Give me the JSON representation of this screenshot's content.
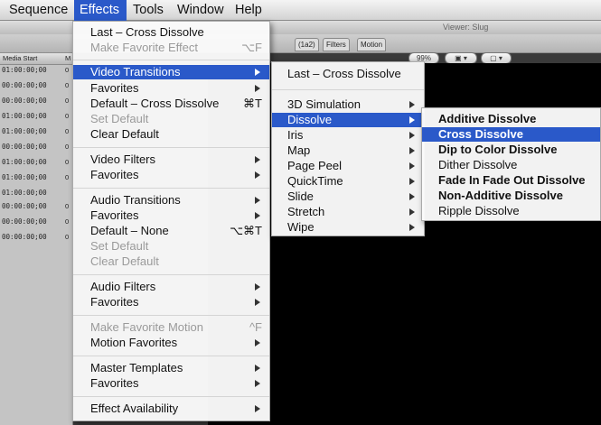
{
  "menubar": {
    "items": [
      {
        "label": "Sequence",
        "active": false
      },
      {
        "label": "Effects",
        "active": true
      },
      {
        "label": "Tools",
        "active": false
      },
      {
        "label": "Window",
        "active": false
      },
      {
        "label": "Help",
        "active": false
      }
    ]
  },
  "background": {
    "viewer_title": "Viewer: Slug",
    "viewer_tabs": [
      "(1a2)",
      "Filters",
      "Motion"
    ],
    "zoom_value": "99%",
    "browser_columns": [
      "Media Start",
      "M"
    ],
    "browser_rows": [
      {
        "tc": "01:00:00;00",
        "suffix": "0"
      },
      {
        "tc": "00:00:00;00",
        "suffix": "0"
      },
      {
        "tc": "00:00:00;00",
        "suffix": "0"
      },
      {
        "tc": "01:00:00;00",
        "suffix": "0"
      },
      {
        "tc": "01:00:00;00",
        "suffix": "0"
      },
      {
        "tc": "00:00:00;00",
        "suffix": "0"
      },
      {
        "tc": "01:00:00;00",
        "suffix": "0"
      },
      {
        "tc": "01:00:00;00",
        "suffix": "0"
      },
      {
        "tc": "01:00:00;00",
        "suffix": ""
      },
      {
        "tc": "00:00:00;00",
        "suffix": "0"
      },
      {
        "tc": "00:00:00;00",
        "suffix": "0"
      },
      {
        "tc": "00:00:00;00",
        "suffix": "0"
      }
    ]
  },
  "effects_menu": {
    "items": [
      {
        "label": "Last – Cross Dissolve"
      },
      {
        "label": "Make Favorite Effect",
        "shortcut": "⌥F",
        "disabled": true
      },
      {
        "label": "Video Transitions",
        "submenu": true,
        "highlighted": true
      },
      {
        "label": "Favorites",
        "submenu": true
      },
      {
        "label": "Default – Cross Dissolve",
        "shortcut": "⌘T"
      },
      {
        "label": "Set Default",
        "disabled": true
      },
      {
        "label": "Clear Default"
      },
      {
        "label": "Video Filters",
        "submenu": true
      },
      {
        "label": "Favorites",
        "submenu": true
      },
      {
        "label": "Audio Transitions",
        "submenu": true
      },
      {
        "label": "Favorites",
        "submenu": true
      },
      {
        "label": "Default – None",
        "shortcut": "⌥⌘T"
      },
      {
        "label": "Set Default",
        "disabled": true
      },
      {
        "label": "Clear Default",
        "disabled": true
      },
      {
        "label": "Audio Filters",
        "submenu": true
      },
      {
        "label": "Favorites",
        "submenu": true
      },
      {
        "label": "Make Favorite Motion",
        "shortcut": "^F",
        "disabled": true
      },
      {
        "label": "Motion Favorites",
        "submenu": true
      },
      {
        "label": "Master Templates",
        "submenu": true
      },
      {
        "label": "Favorites",
        "submenu": true
      },
      {
        "label": "Effect Availability",
        "submenu": true
      }
    ]
  },
  "transitions_menu": {
    "items": [
      {
        "label": "Last – Cross Dissolve"
      },
      {
        "label": "3D Simulation",
        "submenu": true
      },
      {
        "label": "Dissolve",
        "submenu": true,
        "highlighted": true
      },
      {
        "label": "Iris",
        "submenu": true
      },
      {
        "label": "Map",
        "submenu": true
      },
      {
        "label": "Page Peel",
        "submenu": true
      },
      {
        "label": "QuickTime",
        "submenu": true
      },
      {
        "label": "Slide",
        "submenu": true
      },
      {
        "label": "Stretch",
        "submenu": true
      },
      {
        "label": "Wipe",
        "submenu": true
      }
    ]
  },
  "dissolve_menu": {
    "items": [
      {
        "label": "Additive Dissolve",
        "bold": true
      },
      {
        "label": "Cross Dissolve",
        "bold": true,
        "highlighted": true
      },
      {
        "label": "Dip to Color Dissolve",
        "bold": true
      },
      {
        "label": "Dither Dissolve",
        "bold": false
      },
      {
        "label": "Fade In Fade Out Dissolve",
        "bold": true
      },
      {
        "label": "Non-Additive Dissolve",
        "bold": true
      },
      {
        "label": "Ripple Dissolve",
        "bold": false
      }
    ]
  },
  "colors": {
    "highlight": "#2a59c9",
    "menu_bg": "#fafafa"
  }
}
